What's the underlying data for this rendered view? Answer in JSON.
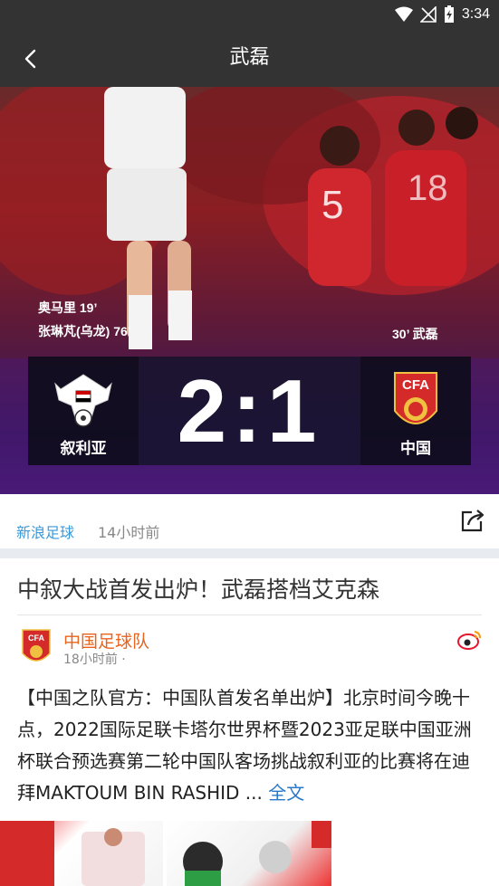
{
  "status_bar": {
    "time": "3:34",
    "icons": [
      "wifi-icon",
      "no-signal-icon",
      "battery-charging-icon"
    ]
  },
  "header": {
    "title": "武磊",
    "back_icon": "chevron-left-icon"
  },
  "match": {
    "home_team": "叙利亚",
    "away_team": "中国",
    "score_home": "2",
    "score_away": "1",
    "home_scorers": [
      "奥马里 19’",
      "张琳芃(乌龙) 76’"
    ],
    "away_scorers": [
      "30’ 武磊"
    ]
  },
  "meta": {
    "source": "新浪足球",
    "time": "14小时前",
    "share_icon": "share-icon"
  },
  "article": {
    "title": "中叙大战首发出炉！武磊搭档艾克森",
    "author": "中国足球队",
    "author_time": "18小时前 ·",
    "body": "【中国之队官方：中国队首发名单出炉】北京时间今晚十点，2022国际足联卡塔尔世界杯暨2023亚足联中国亚洲杯联合预选赛第二轮中国队客场挑战叙利亚的比赛将在迪拜MAKTOUM BIN RASHID ... ",
    "read_more": "全文"
  },
  "colors": {
    "header_bg": "#333333",
    "accent_blue": "#3a9ad9",
    "author_orange": "#e8641e"
  }
}
